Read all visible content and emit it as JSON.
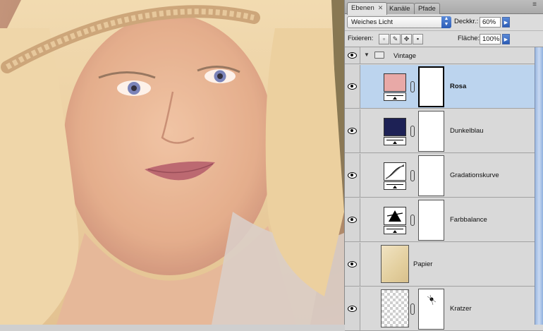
{
  "panel": {
    "tabs": [
      {
        "label": "Ebenen",
        "close": "✕"
      },
      {
        "label": "Kanäle"
      },
      {
        "label": "Pfade"
      }
    ],
    "menu_icon": "≡",
    "blend_mode": "Weiches Licht",
    "opacity_label": "Deckkr.:",
    "opacity_value": "60%",
    "lock_label": "Fixieren:",
    "fill_label": "Fläche:",
    "fill_value": "100%"
  },
  "group": {
    "name": "Vintage"
  },
  "layers": [
    {
      "name": "Rosa",
      "selected": true,
      "swatch": "#e8a9a7"
    },
    {
      "name": "Dunkelblau",
      "swatch": "#1d2155"
    },
    {
      "name": "Gradationskurve"
    },
    {
      "name": "Farbbalance"
    },
    {
      "name": "Papier"
    },
    {
      "name": "Kratzer"
    }
  ],
  "colors": {
    "selection": "#bcd4ee",
    "panel_bg": "#d9d9d9",
    "accent_blue": "#2b5cb6"
  },
  "icons": [
    "eye-icon",
    "folder-icon",
    "chain-icon",
    "curves-icon",
    "balance-icon",
    "lock-icon",
    "move-icon",
    "brush-icon",
    "transparency-icon"
  ]
}
